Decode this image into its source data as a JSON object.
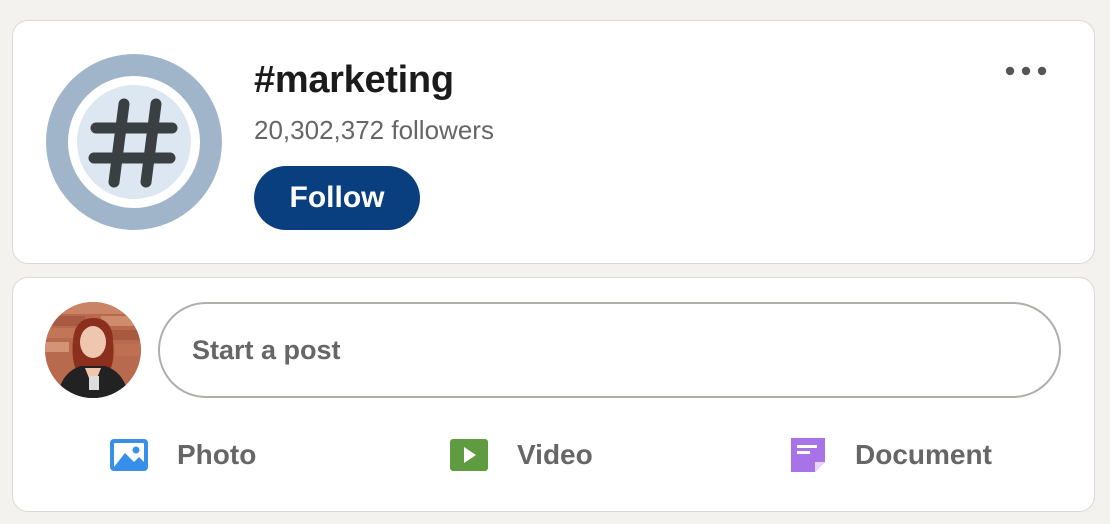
{
  "hashtag": {
    "title": "#marketing",
    "followers": "20,302,372 followers",
    "follow_label": "Follow",
    "more_icon": "more-horizontal-icon",
    "avatar_icon": "hashtag-icon"
  },
  "composer": {
    "placeholder": "Start a post",
    "avatar": "user-avatar",
    "actions": [
      {
        "label": "Photo",
        "icon": "photo-icon",
        "color": "#378fe9"
      },
      {
        "label": "Video",
        "icon": "video-icon",
        "color": "#5f9b41"
      },
      {
        "label": "Document",
        "icon": "document-icon",
        "color": "#a872e8"
      }
    ]
  },
  "colors": {
    "follow_button": "#0a3f7f",
    "background": "#f4f2ee"
  }
}
